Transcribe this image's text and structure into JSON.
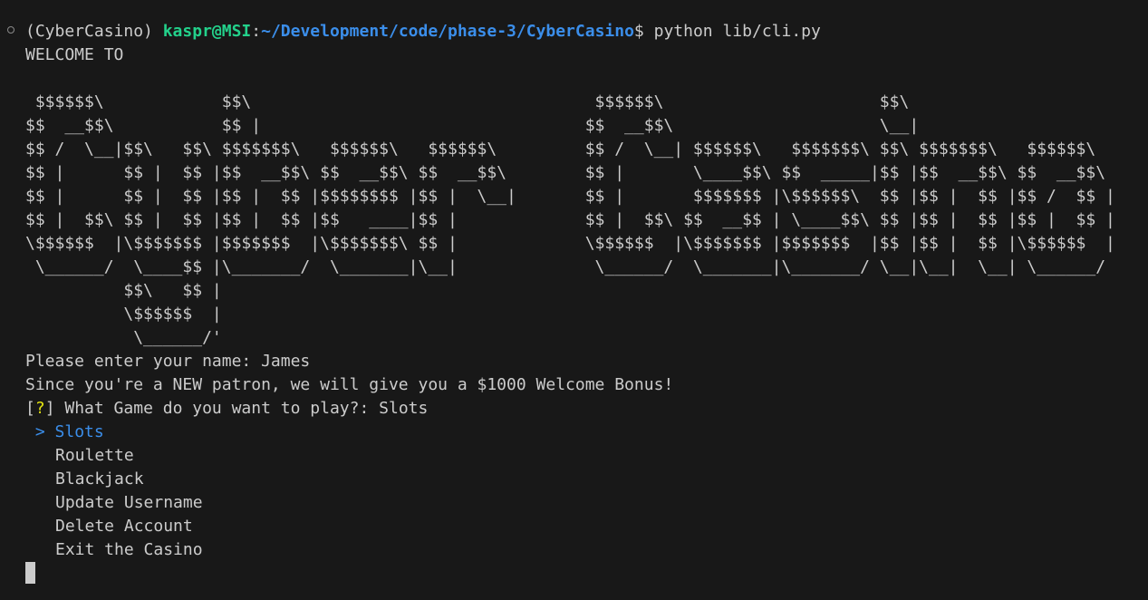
{
  "prompt": {
    "env": "(CyberCasino) ",
    "user_host": "kaspr@MSI",
    "separator": ":",
    "path": "~/Development/code/phase-3/CyberCasino",
    "dollar": "$ ",
    "command": "python lib/cli.py"
  },
  "welcome": "WELCOME TO",
  "banner": [
    " $$$$$$\\            $$\\                                   $$$$$$\\                      $$\\",
    "$$  __$$\\           $$ |                                 $$  __$$\\                     \\__|",
    "$$ /  \\__|$$\\   $$\\ $$$$$$$\\   $$$$$$\\   $$$$$$\\         $$ /  \\__| $$$$$$\\   $$$$$$$\\ $$\\ $$$$$$$\\   $$$$$$\\",
    "$$ |      $$ |  $$ |$$  __$$\\ $$  __$$\\ $$  __$$\\        $$ |       \\____$$\\ $$  _____|$$ |$$  __$$\\ $$  __$$\\",
    "$$ |      $$ |  $$ |$$ |  $$ |$$$$$$$$ |$$ |  \\__|       $$ |       $$$$$$$ |\\$$$$$$\\  $$ |$$ |  $$ |$$ /  $$ |",
    "$$ |  $$\\ $$ |  $$ |$$ |  $$ |$$   ____|$$ |             $$ |  $$\\ $$  __$$ | \\____$$\\ $$ |$$ |  $$ |$$ |  $$ |",
    "\\$$$$$$  |\\$$$$$$$ |$$$$$$$  |\\$$$$$$$\\ $$ |             \\$$$$$$  |\\$$$$$$$ |$$$$$$$  |$$ |$$ |  $$ |\\$$$$$$  |",
    " \\______/  \\____$$ |\\_______/  \\_______|\\__|              \\______/  \\_______|\\_______/ \\__|\\__|  \\__| \\______/",
    "          $$\\   $$ |",
    "          \\$$$$$$  |",
    "           \\______/'"
  ],
  "name_prompt": "Please enter your name: James",
  "bonus_message": "Since you're a NEW patron, we will give you a $1000 Welcome Bonus!",
  "question": {
    "bracket_open": "[",
    "mark": "?",
    "bracket_close": "]",
    "text": " What Game do you want to play?: Slots"
  },
  "menu": {
    "pointer": " > ",
    "selected": "Slots",
    "options": [
      "Roulette",
      "Blackjack",
      "Update Username",
      "Delete Account",
      "Exit the Casino"
    ]
  },
  "colors": {
    "background": "#181818",
    "text": "#cccccc",
    "user_host": "#23d18b",
    "path": "#3b8eea",
    "question_mark": "#e5e510",
    "selected": "#3b8eea"
  }
}
